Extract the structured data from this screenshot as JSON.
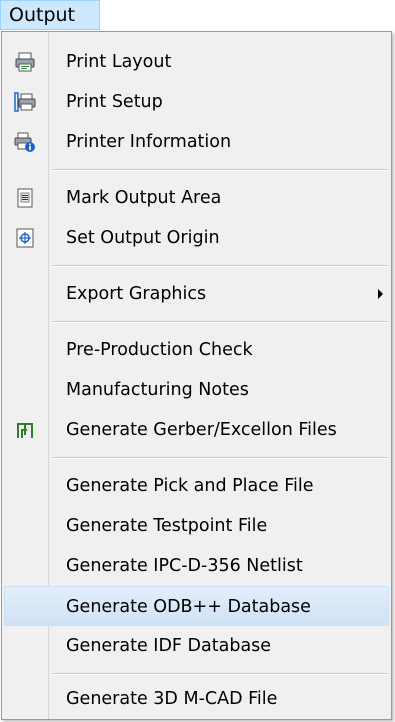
{
  "menubar": {
    "title": "Output"
  },
  "menu": {
    "items": [
      {
        "label": "Print Layout",
        "icon": "printer-icon"
      },
      {
        "label": "Print Setup",
        "icon": "printer-setup-icon"
      },
      {
        "label": "Printer Information",
        "icon": "printer-info-icon"
      },
      {
        "label": "Mark Output Area",
        "icon": "output-area-icon"
      },
      {
        "label": "Set Output Origin",
        "icon": "origin-icon"
      },
      {
        "label": "Export Graphics",
        "submenu": true
      },
      {
        "label": "Pre-Production Check"
      },
      {
        "label": "Manufacturing Notes"
      },
      {
        "label": "Generate Gerber/Excellon Files",
        "icon": "gerber-icon"
      },
      {
        "label": "Generate Pick and Place File"
      },
      {
        "label": "Generate Testpoint File"
      },
      {
        "label": "Generate IPC-D-356 Netlist"
      },
      {
        "label": "Generate ODB++ Database",
        "highlighted": true
      },
      {
        "label": "Generate IDF Database"
      },
      {
        "label": "Generate 3D M-CAD File"
      }
    ]
  },
  "colors": {
    "accent": "#cce8ff",
    "highlight": "#d8e8f7",
    "menu_bg": "#f0f0f0"
  }
}
